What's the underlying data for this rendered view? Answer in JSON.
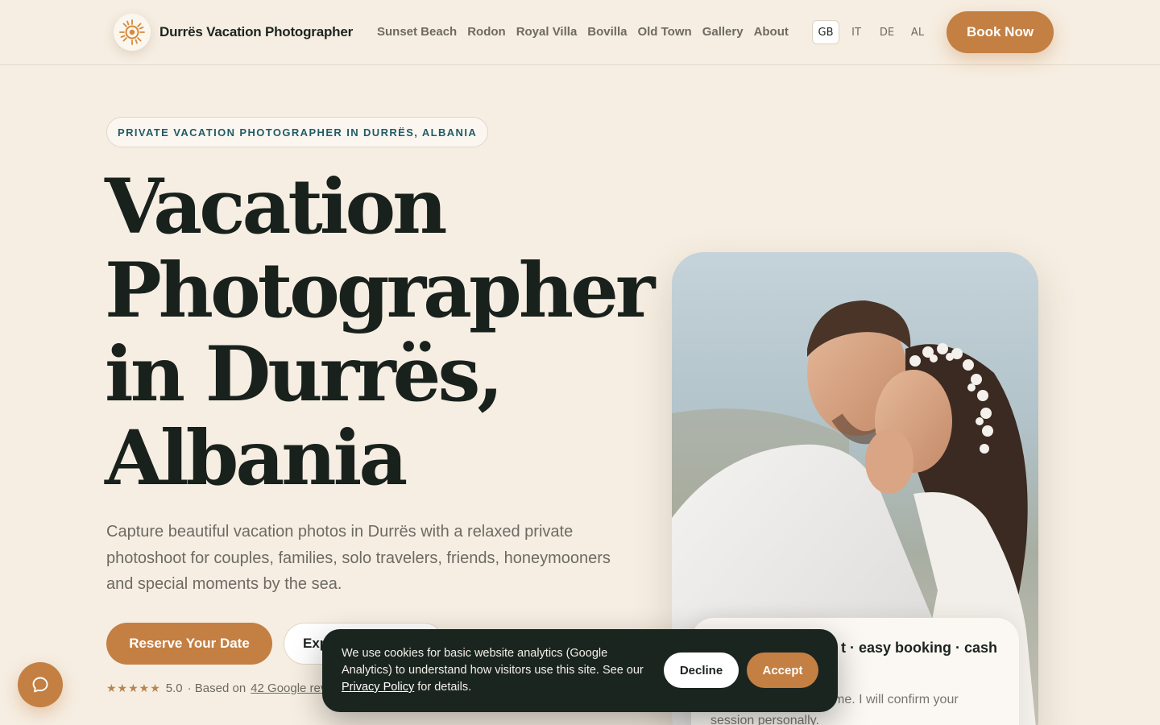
{
  "header": {
    "brand": "Durrës Vacation Photographer",
    "logo_icon": "sun-logo-icon",
    "nav": [
      "Sunset Beach",
      "Rodon",
      "Royal Villa",
      "Bovilla",
      "Old Town",
      "Gallery",
      "About"
    ],
    "languages": [
      {
        "label": "GB",
        "active": true
      },
      {
        "label": "IT",
        "active": false
      },
      {
        "label": "DE",
        "active": false
      },
      {
        "label": "AL",
        "active": false
      }
    ],
    "book_label": "Book Now"
  },
  "hero": {
    "eyebrow": "PRIVATE VACATION PHOTOGRAPHER IN DURRËS, ALBANIA",
    "title_lines": [
      "Vacation",
      "Photographer",
      "in Durrës,",
      "Albania"
    ],
    "lead": "Capture beautiful vacation photos in Durrës with a relaxed private photoshoot for couples, families, solo travelers, friends, honeymooners and special moments by the sea.",
    "primary_cta": "Reserve Your Date",
    "secondary_cta": "Exp",
    "rating": {
      "stars": "★★★★★",
      "score": "5.0",
      "prefix": "· Based on",
      "link": "42 Google revi"
    }
  },
  "photo_card": {
    "info_title": "t · easy booking · cash",
    "info_body": ", date and preferred time. I will confirm your session personally."
  },
  "cookie": {
    "text": "We use cookies for basic website analytics (Google Analytics) to understand how visitors use this site. See our",
    "policy_link": "Privacy Policy",
    "suffix": "for details.",
    "decline": "Decline",
    "accept": "Accept"
  },
  "chat": {
    "icon": "chat-bubble-icon"
  },
  "colors": {
    "background": "#f6eee2",
    "accent": "#c47f43",
    "heading": "#19211d",
    "eyebrow": "#1f5b68",
    "cookie_bg": "#1b2520"
  }
}
